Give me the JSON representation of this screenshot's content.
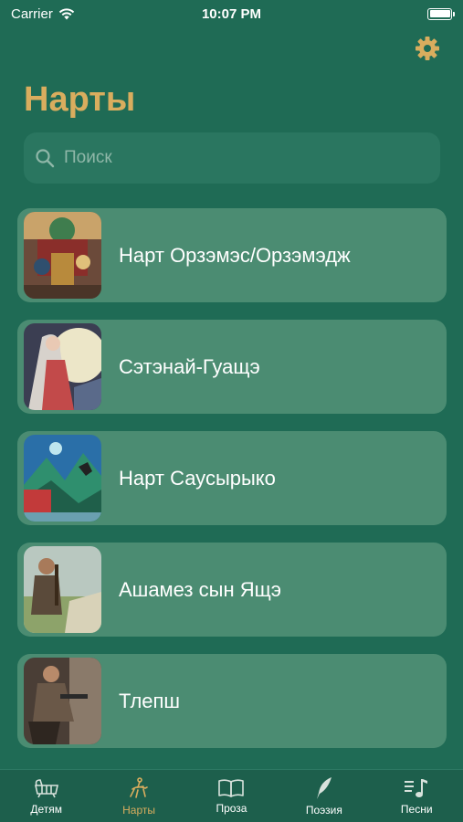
{
  "status": {
    "carrier": "Carrier",
    "time": "10:07 PM"
  },
  "header": {
    "title": "Нарты",
    "settings_icon": "gear-icon"
  },
  "search": {
    "placeholder": "Поиск",
    "value": ""
  },
  "colors": {
    "accent": "#d9ad5e",
    "background": "#1f6b55",
    "card": "#4b8c72",
    "tabbar": "#1d5f4c"
  },
  "list": [
    {
      "title": "Нарт Орзэмэс/Орзэмэдж",
      "image": "narts-painting-thumbnail"
    },
    {
      "title": "Сэтэнай-Гуащэ",
      "image": "woman-portrait-thumbnail"
    },
    {
      "title": "Нарт Саусырыко",
      "image": "mountain-landscape-thumbnail"
    },
    {
      "title": "Ашамез сын Ящэ",
      "image": "musician-thumbnail"
    },
    {
      "title": "Тлепш",
      "image": "blacksmith-thumbnail"
    }
  ],
  "tabs": [
    {
      "label": "Детям",
      "icon": "cradle-icon",
      "active": false
    },
    {
      "label": "Нарты",
      "icon": "horseman-icon",
      "active": true
    },
    {
      "label": "Проза",
      "icon": "book-icon",
      "active": false
    },
    {
      "label": "Поэзия",
      "icon": "quill-icon",
      "active": false
    },
    {
      "label": "Песни",
      "icon": "music-note-icon",
      "active": false
    }
  ]
}
